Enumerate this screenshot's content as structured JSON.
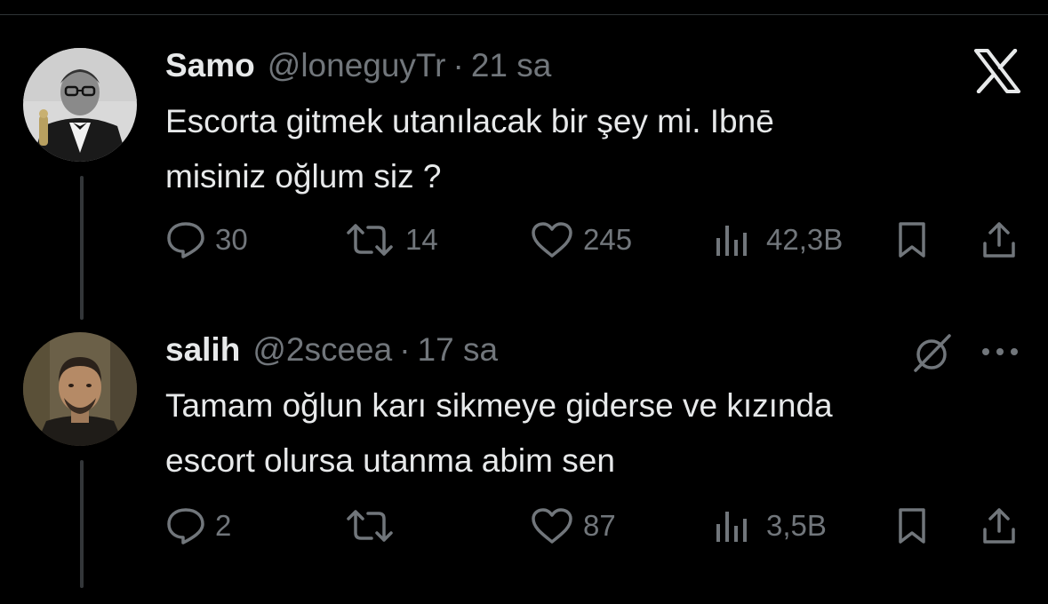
{
  "close_label": "Close",
  "tweets": [
    {
      "name": "Samo",
      "handle": "@loneguyTr",
      "separator": "·",
      "time": "21 sa",
      "text_lines": [
        "Escorta gitmek utanılacak bir şey mi. Ibnē",
        "misiniz oğlum siz ?"
      ],
      "replies": "30",
      "retweets": "14",
      "likes": "245",
      "views": "42,3B"
    },
    {
      "name": "salih",
      "handle": "@2sceea",
      "separator": "·",
      "time": "17 sa",
      "text_lines": [
        "Tamam oğlun karı sikmeye giderse ve kızında",
        "escort olursa utanma abim sen"
      ],
      "replies": "2",
      "retweets": "",
      "likes": "87",
      "views": "3,5B"
    }
  ],
  "icons": {
    "close": "x-logo-icon",
    "reply": "speech-bubble-icon",
    "retweet": "retweet-icon",
    "like": "heart-icon",
    "views": "bar-chart-icon",
    "bookmark": "bookmark-icon",
    "share": "share-icon",
    "grok": "grok-icon",
    "more": "more-horizontal-icon"
  },
  "colors": {
    "background": "#000000",
    "primary_text": "#e7e9ea",
    "secondary_text": "#71767b",
    "thread_line": "#333639"
  }
}
